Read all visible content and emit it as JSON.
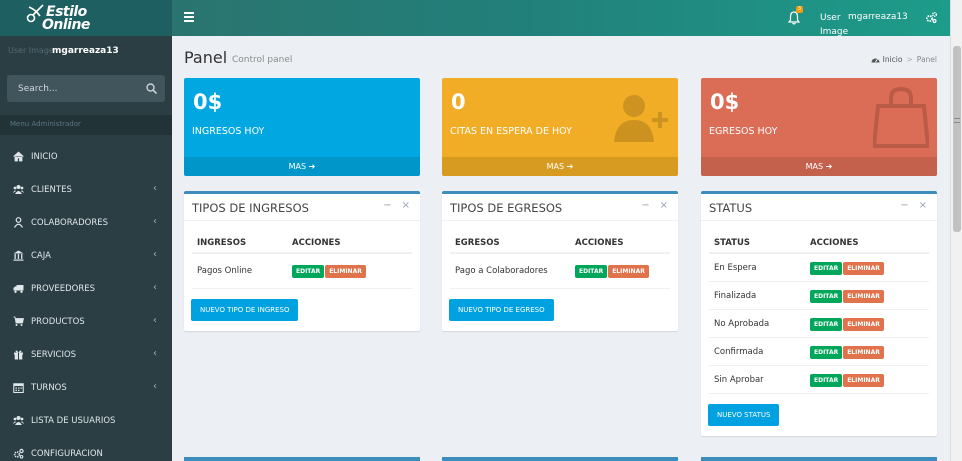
{
  "brand": {
    "line1": "Estilo",
    "line2": "Online"
  },
  "topbar": {
    "notifications_count": "3",
    "user_image_alt": "User Image",
    "user_name": "mgarreaza13"
  },
  "sidebar": {
    "user_image_alt": "User Image",
    "user_name": "mgarreaza13",
    "search_placeholder": "Search...",
    "menu_header": "Menu Administrador",
    "items": [
      {
        "label": "INICIO",
        "icon": "home-icon",
        "has_children": false
      },
      {
        "label": "CLIENTES",
        "icon": "users-icon",
        "has_children": true
      },
      {
        "label": "COLABORADORES",
        "icon": "user-tie-icon",
        "has_children": true
      },
      {
        "label": "CAJA",
        "icon": "bank-icon",
        "has_children": true
      },
      {
        "label": "PROVEEDORES",
        "icon": "truck-icon",
        "has_children": true
      },
      {
        "label": "PRODUCTOS",
        "icon": "cart-icon",
        "has_children": true
      },
      {
        "label": "SERVICIOS",
        "icon": "gift-icon",
        "has_children": true
      },
      {
        "label": "TURNOS",
        "icon": "calendar-icon",
        "has_children": true
      },
      {
        "label": "LISTA DE USUARIOS",
        "icon": "users-icon",
        "has_children": false
      },
      {
        "label": "CONFIGURACION",
        "icon": "cogs-icon",
        "has_children": false
      }
    ]
  },
  "header": {
    "title": "Panel",
    "subtitle": "Control panel",
    "breadcrumb": [
      "Inicio",
      "Panel"
    ]
  },
  "stat_boxes": [
    {
      "value": "0$",
      "label": "INGRESOS HOY",
      "more": "MAS",
      "color": "#00a7e0",
      "icon": "none"
    },
    {
      "value": "0",
      "label": "CITAS EN ESPERA DE HOY",
      "more": "MAS",
      "color": "#f1ad26",
      "icon": "user-plus-icon"
    },
    {
      "value": "0$",
      "label": "EGRESOS HOY",
      "more": "MAS",
      "color": "#db6c55",
      "icon": "shopping-bag-icon"
    }
  ],
  "boxes": {
    "ingresos": {
      "title": "TIPOS DE INGRESOS",
      "col1": "INGRESOS",
      "col2": "ACCIONES",
      "rows": [
        {
          "name": "Pagos Online"
        }
      ],
      "add_button": "NUEVO TIPO DE INGRESO"
    },
    "egresos": {
      "title": "TIPOS DE EGRESOS",
      "col1": "EGRESOS",
      "col2": "ACCIONES",
      "rows": [
        {
          "name": "Pago a Colaboradores"
        }
      ],
      "add_button": "NUEVO TIPO DE EGRESO"
    },
    "status": {
      "title": "STATUS",
      "col1": "STATUS",
      "col2": "ACCIONES",
      "rows": [
        {
          "name": "En Espera"
        },
        {
          "name": "Finalizada"
        },
        {
          "name": "No Aprobada"
        },
        {
          "name": "Confirmada"
        },
        {
          "name": "Sin Aprobar"
        }
      ],
      "add_button": "NUEVO STATUS"
    }
  },
  "actions": {
    "edit": "EDITAR",
    "delete": "ELIMINAR"
  },
  "box_tools": {
    "collapse": "−",
    "remove": "×"
  }
}
